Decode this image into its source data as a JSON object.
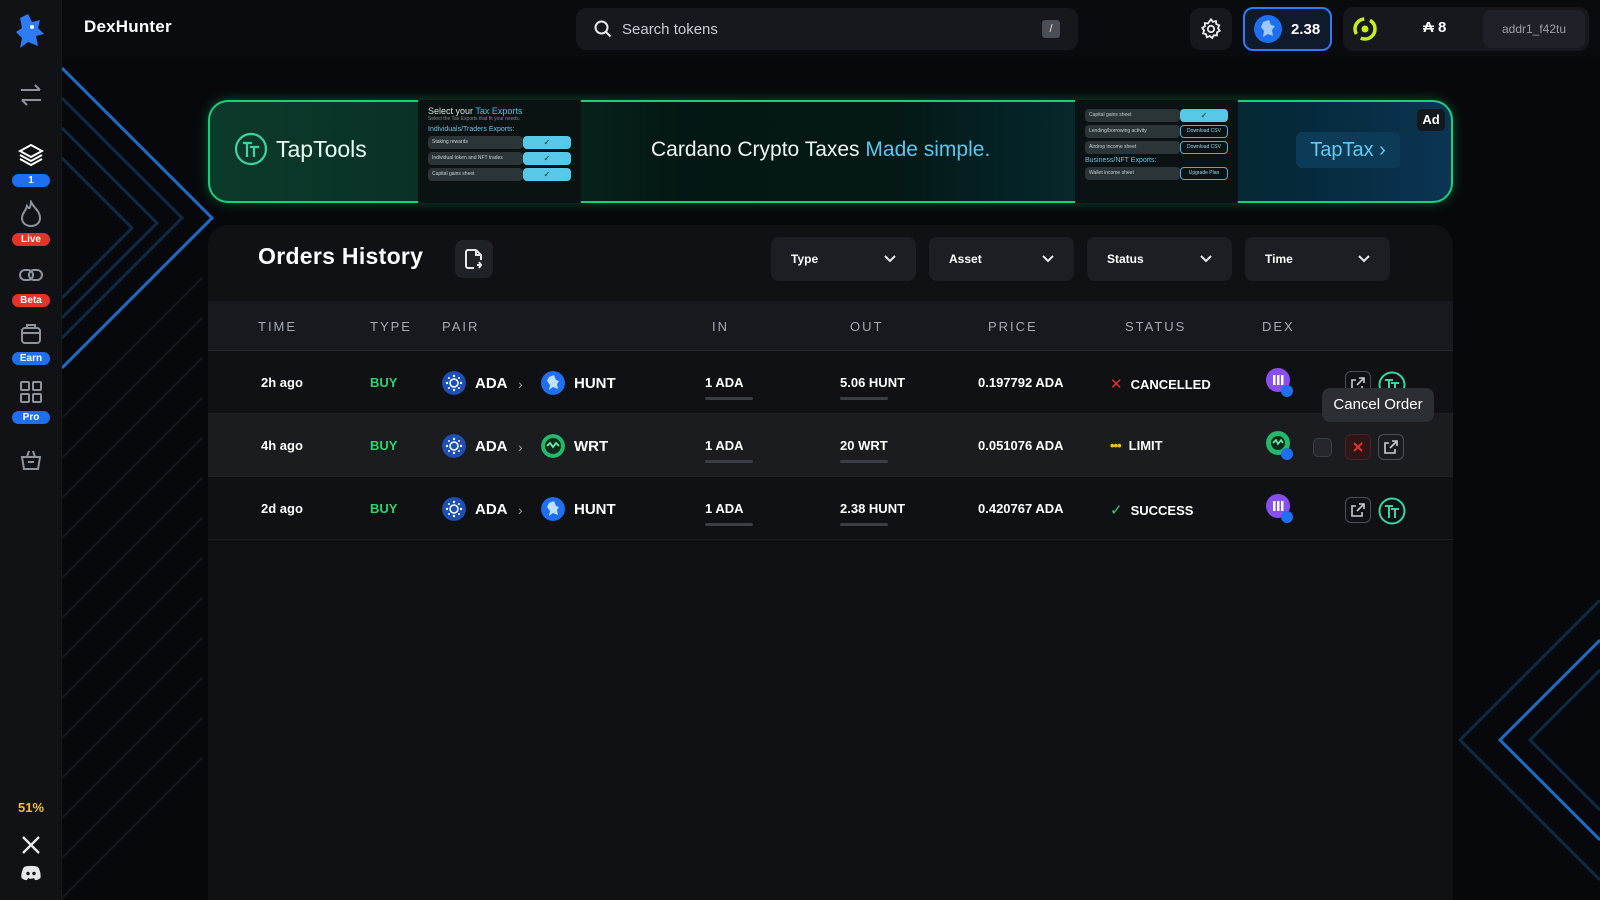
{
  "app": {
    "brand": "DexHunter"
  },
  "search": {
    "placeholder": "Search tokens",
    "shortcut": "/"
  },
  "header": {
    "balance": "2.38",
    "ada_balance": "₳ 8",
    "address": "addr1_f42tu"
  },
  "sidebar": {
    "items": [
      {
        "icon": "swap-icon",
        "badge": ""
      },
      {
        "icon": "layers-icon",
        "badge": "1"
      },
      {
        "icon": "fire-icon",
        "badge": "Live"
      },
      {
        "icon": "link-icon",
        "badge": "Beta"
      },
      {
        "icon": "bag-icon",
        "badge": "Earn"
      },
      {
        "icon": "grid-icon",
        "badge": "Pro"
      },
      {
        "icon": "basket-icon",
        "badge": ""
      }
    ],
    "percent": "51%"
  },
  "ad": {
    "brand": "TapTools",
    "tag": "Ad",
    "headline_main": "Cardano Crypto Taxes",
    "headline_highlight": "Made simple.",
    "cta": "TapTax ›",
    "left_panel": {
      "title": "Select your",
      "title_highlight": "Tax Exports",
      "subtitle": "Select the Tax Exports that fit your needs.",
      "section": "Individuals/Traders Exports:",
      "rows": [
        "Staking rewards",
        "Individual token and NFT trades",
        "Capital gains sheet"
      ],
      "check": "✓"
    },
    "right_panel": {
      "rows": [
        {
          "label": "Capital gains sheet",
          "action": "✓"
        },
        {
          "label": "Lending/borrowing activity",
          "action": "Download CSV"
        },
        {
          "label": "Airdrop income sheet",
          "action": "Download CSV"
        }
      ],
      "section": "Business/NFT Exports:",
      "row_business": {
        "label": "Wallet income sheet",
        "action": "Upgrade Plan"
      }
    }
  },
  "orders": {
    "title": "Orders History",
    "filters": [
      "Type",
      "Asset",
      "Status",
      "Time"
    ],
    "columns": [
      "TIME",
      "TYPE",
      "PAIR",
      "IN",
      "OUT",
      "PRICE",
      "STATUS",
      "DEX"
    ],
    "rows": [
      {
        "time": "2h ago",
        "type": "BUY",
        "from": "ADA",
        "to": "HUNT",
        "in": "1 ADA",
        "out": "5.06 HUNT",
        "price": "0.197792 ADA",
        "status": "CANCELLED",
        "status_icon": "✕"
      },
      {
        "time": "4h ago",
        "type": "BUY",
        "from": "ADA",
        "to": "WRT",
        "in": "1 ADA",
        "out": "20 WRT",
        "price": "0.051076 ADA",
        "status": "LIMIT",
        "status_icon": "•••"
      },
      {
        "time": "2d ago",
        "type": "BUY",
        "from": "ADA",
        "to": "HUNT",
        "in": "1 ADA",
        "out": "2.38 HUNT",
        "price": "0.420767 ADA",
        "status": "SUCCESS",
        "status_icon": "✓"
      }
    ],
    "tooltip": "Cancel Order"
  },
  "colors": {
    "accent_blue": "#2f7af5",
    "buy_green": "#2bd46b",
    "cancel_red": "#e5322d",
    "limit_yellow": "#f4c21b",
    "ad_border": "#19d07a"
  }
}
